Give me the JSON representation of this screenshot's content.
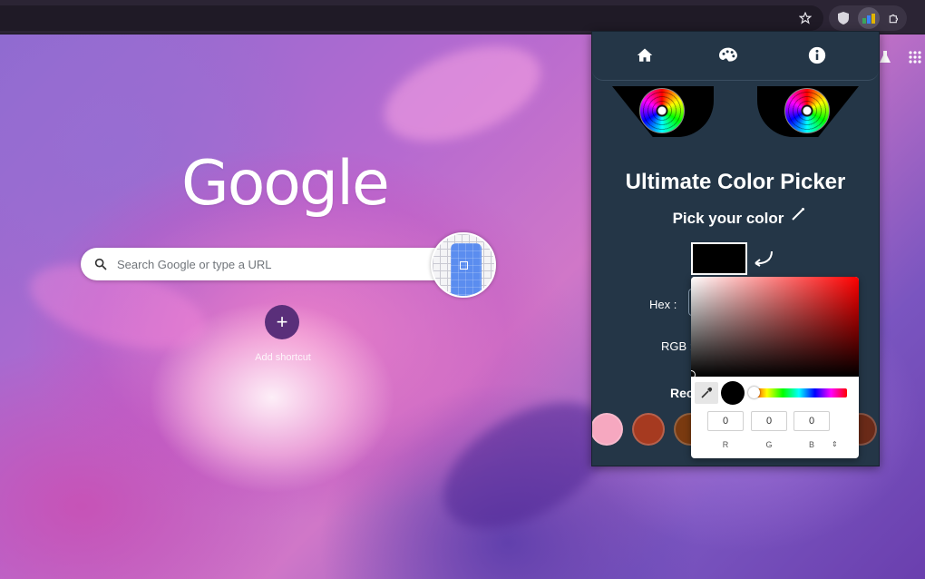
{
  "colors": {
    "popup_bg": "#243647",
    "picked_color": "#000000",
    "add_shortcut_bg": "#5a2f7a"
  },
  "icons": {
    "bookmark": "star-icon",
    "ext1": "shield-icon",
    "ext2": "color-picker-extension-icon",
    "ext3": "puzzle-icon",
    "nav_home": "home-icon",
    "nav_palette": "palette-icon",
    "nav_info": "info-icon"
  },
  "newtab": {
    "logo_text": "Google",
    "search_placeholder": "Search Google or type a URL",
    "add_shortcut_glyph": "+",
    "add_shortcut_label": "Add shortcut"
  },
  "popup": {
    "title": "Ultimate Color Picker",
    "subtitle": "Pick your color",
    "hex_label": "Hex :",
    "rgb_label": "RGB :",
    "recent_label": "Rec",
    "recent_colors": [
      "#f6a8c0",
      "#a63a20",
      "#7a3a10",
      "#6a2a18"
    ]
  },
  "picker": {
    "r_value": "0",
    "g_value": "0",
    "b_value": "0",
    "r_label": "R",
    "g_label": "G",
    "b_label": "B",
    "toggle_glyph": "⇕"
  }
}
